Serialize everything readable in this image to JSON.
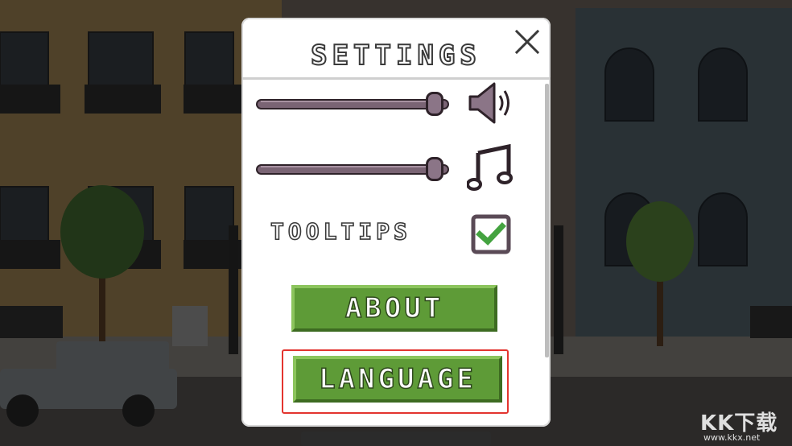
{
  "panel": {
    "title": "SETTINGS",
    "close_icon": "close-x-icon"
  },
  "sliders": [
    {
      "name": "sound-volume",
      "icon": "speaker-icon",
      "level": 0.97
    },
    {
      "name": "music-volume",
      "icon": "music-note-icon",
      "level": 0.97
    }
  ],
  "tooltips": {
    "label": "TOOLTIPS",
    "checked": true,
    "check_icon": "checkmark-icon"
  },
  "buttons": {
    "about": "ABOUT",
    "language": "LANGUAGE"
  },
  "watermark": {
    "logo": "KK下载",
    "url": "www.kkx.net"
  },
  "colors": {
    "button_green": "#5e9b37",
    "slider_track": "#7a6474",
    "highlight_red": "#e3342f",
    "check_green": "#44a340"
  }
}
